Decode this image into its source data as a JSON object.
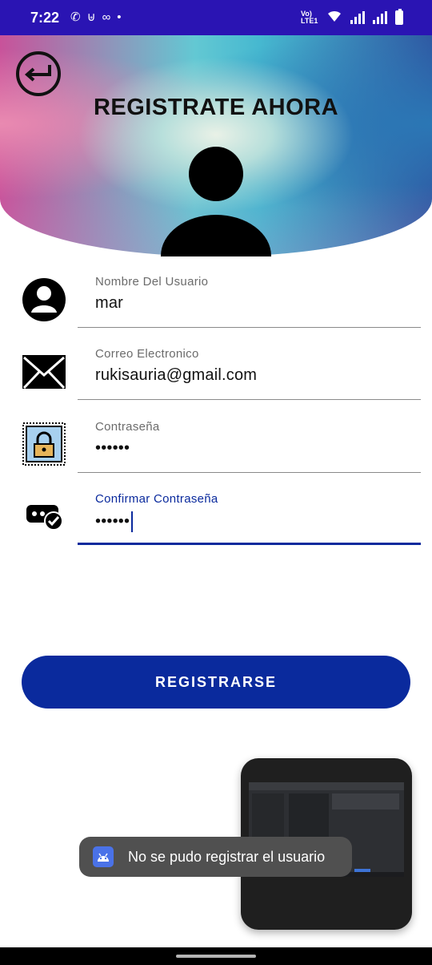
{
  "status_bar": {
    "time": "7:22",
    "left_icons": [
      "phone-icon",
      "usb-icon",
      "voicemail-icon",
      "dot-icon"
    ],
    "right_icons": [
      "volte-icon",
      "wifi-icon",
      "signal-icon",
      "signal-icon",
      "battery-charging-icon"
    ],
    "volte_label": "Vo) LTE1"
  },
  "header": {
    "title": "REGISTRATE AHORA",
    "back_icon": "back-arrow-icon",
    "avatar_icon": "user-silhouette-icon"
  },
  "form": {
    "fields": [
      {
        "icon": "user-circle-icon",
        "label": "Nombre Del Usuario",
        "value": "mar"
      },
      {
        "icon": "envelope-icon",
        "label": "Correo Electronico",
        "value": "rukisauria@gmail.com"
      },
      {
        "icon": "lock-icon",
        "label": "Contraseña",
        "value": "••••••"
      },
      {
        "icon": "password-check-icon",
        "label": "Confirmar Contraseña",
        "value": "••••••"
      }
    ]
  },
  "register_button": {
    "label": "REGISTRARSE"
  },
  "toast": {
    "icon": "android-icon",
    "message": "No se pudo registrar el usuario"
  },
  "colors": {
    "status_bar": "#2a14b3",
    "primary": "#0a2a9d",
    "toast_bg": "#505050"
  }
}
